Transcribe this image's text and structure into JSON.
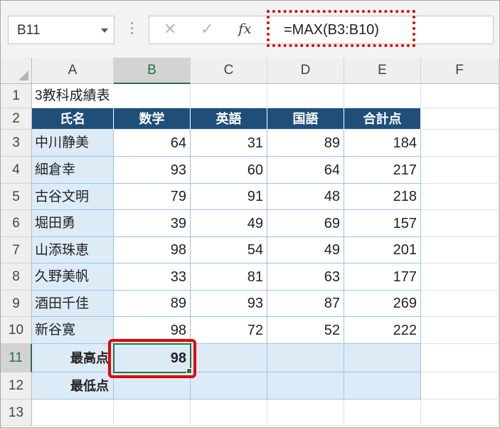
{
  "name_box": {
    "value": "B11"
  },
  "formula_bar": {
    "formula": "=MAX(B3:B10)",
    "fx_label": "fx",
    "cancel_glyph": "✕",
    "enter_glyph": "✓"
  },
  "columns": [
    "A",
    "B",
    "C",
    "D",
    "E",
    "F"
  ],
  "rows": [
    "1",
    "2",
    "3",
    "4",
    "5",
    "6",
    "7",
    "8",
    "9",
    "10",
    "11",
    "12",
    "13"
  ],
  "sheet": {
    "title": "3教科成績表",
    "headers": [
      "氏名",
      "数学",
      "英語",
      "国語",
      "合計点"
    ],
    "students": [
      {
        "name": "中川静美",
        "math": "64",
        "english": "31",
        "japanese": "89",
        "total": "184"
      },
      {
        "name": "細倉幸",
        "math": "93",
        "english": "60",
        "japanese": "64",
        "total": "217"
      },
      {
        "name": "古谷文明",
        "math": "79",
        "english": "91",
        "japanese": "48",
        "total": "218"
      },
      {
        "name": "堀田勇",
        "math": "39",
        "english": "49",
        "japanese": "69",
        "total": "157"
      },
      {
        "name": "山添珠恵",
        "math": "98",
        "english": "54",
        "japanese": "49",
        "total": "201"
      },
      {
        "name": "久野美帆",
        "math": "33",
        "english": "81",
        "japanese": "63",
        "total": "177"
      },
      {
        "name": "酒田千佳",
        "math": "89",
        "english": "93",
        "japanese": "87",
        "total": "269"
      },
      {
        "name": "新谷寛",
        "math": "98",
        "english": "72",
        "japanese": "52",
        "total": "222"
      }
    ],
    "max_label": "最高点",
    "max_math": "98",
    "min_label": "最低点"
  },
  "colors": {
    "header_fill": "#1f4e79",
    "light_fill": "#ddebf7",
    "highlight": "#e40000",
    "selection": "#217346"
  }
}
